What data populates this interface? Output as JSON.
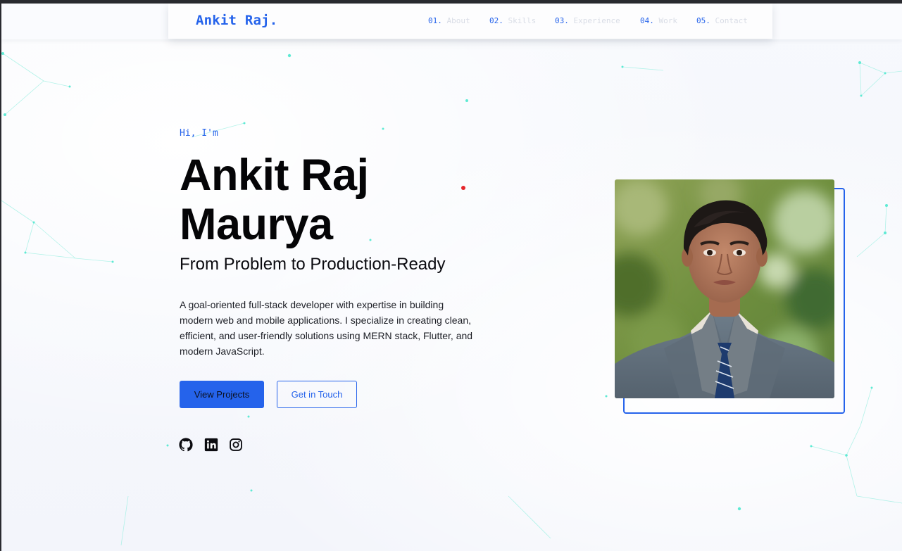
{
  "brand": {
    "name": "Ankit Raj."
  },
  "nav": {
    "items": [
      {
        "num": "01.",
        "label": "About"
      },
      {
        "num": "02.",
        "label": "Skills"
      },
      {
        "num": "03.",
        "label": "Experience"
      },
      {
        "num": "04.",
        "label": "Work"
      },
      {
        "num": "05.",
        "label": "Contact"
      }
    ]
  },
  "hero": {
    "greeting": "Hi, I'm",
    "name_line1": "Ankit Raj",
    "name_line2": "Maurya",
    "tagline": "From Problem to Production-Ready",
    "description": "A goal-oriented full-stack developer with expertise in building modern web and mobile applications. I specialize in creating clean, efficient, and user-friendly solutions using MERN stack, Flutter, and modern JavaScript.",
    "primary_button": "View Projects",
    "secondary_button": "Get in Touch"
  },
  "social": {
    "icons": [
      "github-icon",
      "linkedin-icon",
      "instagram-icon"
    ]
  },
  "colors": {
    "accent": "#2563eb",
    "nav_label": "#d9dde6",
    "network": "#5eead4",
    "cursor": "#e5252a",
    "text": "#0b0b10"
  }
}
